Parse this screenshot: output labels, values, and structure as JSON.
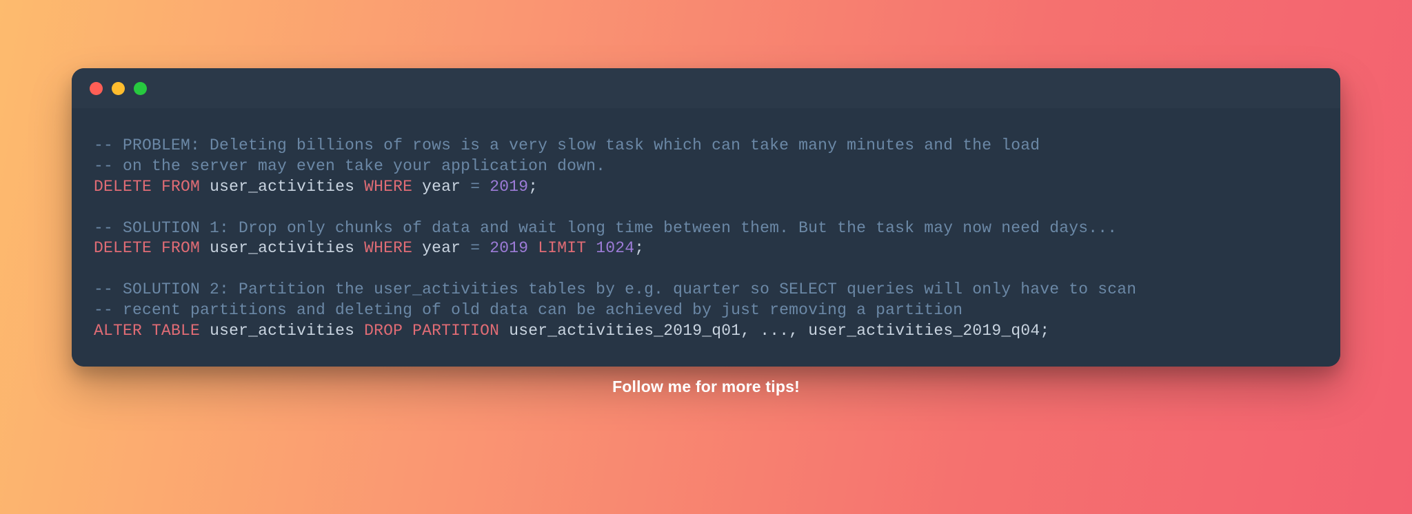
{
  "footer": "Follow me for more tips!",
  "code": {
    "tokens": [
      [
        "cm",
        "-- PROBLEM: Deleting billions of rows is a very slow task which can take many minutes and the load"
      ],
      [
        "nl"
      ],
      [
        "cm",
        "-- on the server may even take your application down."
      ],
      [
        "nl"
      ],
      [
        "kw",
        "DELETE"
      ],
      [
        "sp"
      ],
      [
        "kw",
        "FROM"
      ],
      [
        "sp"
      ],
      [
        "id",
        "user_activities"
      ],
      [
        "sp"
      ],
      [
        "kw",
        "WHERE"
      ],
      [
        "sp"
      ],
      [
        "id",
        "year"
      ],
      [
        "sp"
      ],
      [
        "op",
        "="
      ],
      [
        "sp"
      ],
      [
        "num",
        "2019"
      ],
      [
        "pn",
        ";"
      ],
      [
        "nl"
      ],
      [
        "nl"
      ],
      [
        "cm",
        "-- SOLUTION 1: Drop only chunks of data and wait long time between them. But the task may now need days..."
      ],
      [
        "nl"
      ],
      [
        "kw",
        "DELETE"
      ],
      [
        "sp"
      ],
      [
        "kw",
        "FROM"
      ],
      [
        "sp"
      ],
      [
        "id",
        "user_activities"
      ],
      [
        "sp"
      ],
      [
        "kw",
        "WHERE"
      ],
      [
        "sp"
      ],
      [
        "id",
        "year"
      ],
      [
        "sp"
      ],
      [
        "op",
        "="
      ],
      [
        "sp"
      ],
      [
        "num",
        "2019"
      ],
      [
        "sp"
      ],
      [
        "kw",
        "LIMIT"
      ],
      [
        "sp"
      ],
      [
        "num",
        "1024"
      ],
      [
        "pn",
        ";"
      ],
      [
        "nl"
      ],
      [
        "nl"
      ],
      [
        "cm",
        "-- SOLUTION 2: Partition the user_activities tables by e.g. quarter so SELECT queries will only have to scan"
      ],
      [
        "nl"
      ],
      [
        "cm",
        "-- recent partitions and deleting of old data can be achieved by just removing a partition"
      ],
      [
        "nl"
      ],
      [
        "kw",
        "ALTER"
      ],
      [
        "sp"
      ],
      [
        "kw",
        "TABLE"
      ],
      [
        "sp"
      ],
      [
        "id",
        "user_activities"
      ],
      [
        "sp"
      ],
      [
        "kw",
        "DROP"
      ],
      [
        "sp"
      ],
      [
        "kw",
        "PARTITION"
      ],
      [
        "sp"
      ],
      [
        "id",
        "user_activities_2019_q01"
      ],
      [
        "pn",
        ", ..., "
      ],
      [
        "id",
        "user_activities_2019_q04"
      ],
      [
        "pn",
        ";"
      ]
    ]
  }
}
